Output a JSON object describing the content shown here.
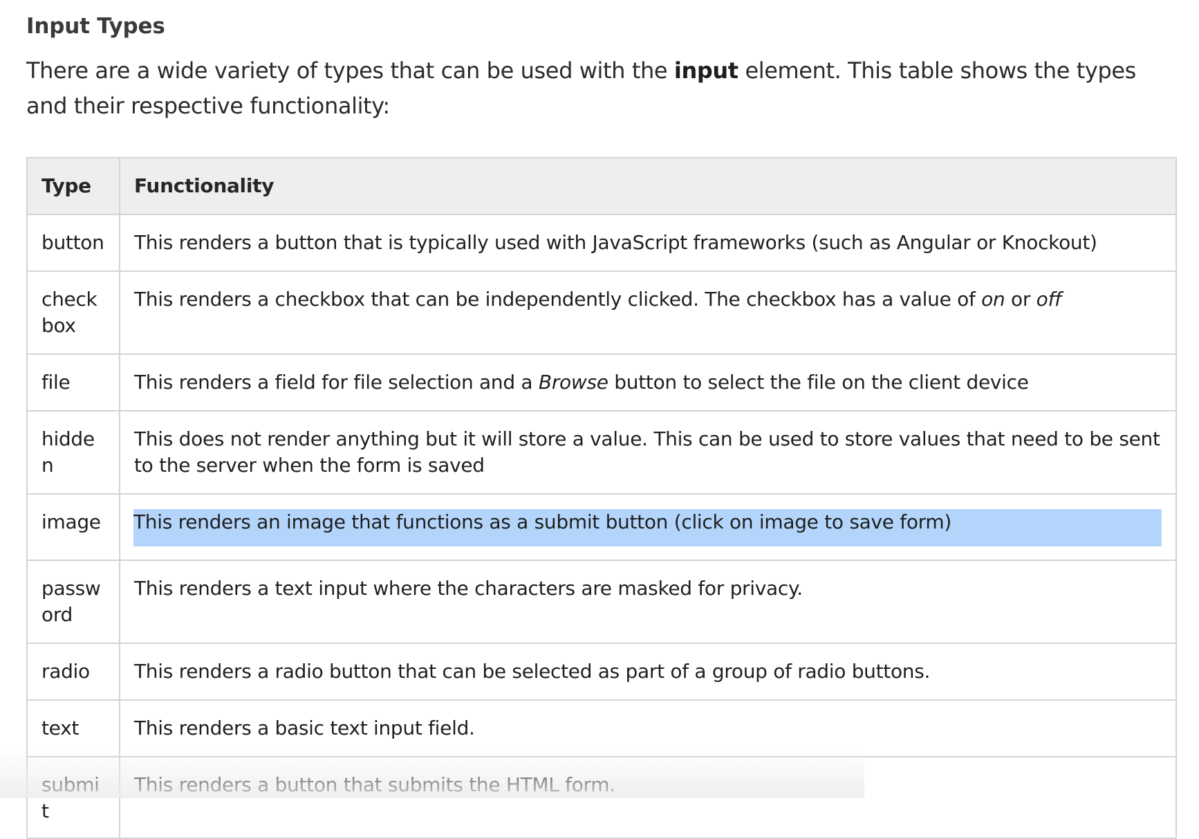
{
  "heading": "Input Types",
  "intro": {
    "before": "There are a wide variety of types that can be used with the ",
    "bold": "input",
    "after": " element. This table shows the types and their respective functionality:"
  },
  "table": {
    "headers": [
      "Type",
      "Functionality"
    ],
    "rows": [
      {
        "type": "button",
        "desc": "This renders a button that is typically used with JavaScript frameworks (such as Angular or Knockout)"
      },
      {
        "type": "checkbox",
        "desc_a": "This renders a checkbox that can be independently clicked. The checkbox has a value of ",
        "em1": "on",
        "desc_b": " or ",
        "em2": "off"
      },
      {
        "type": "file",
        "desc_a": "This renders a field for file selection and a ",
        "em1": "Browse",
        "desc_b": " button to select the file on the client device"
      },
      {
        "type": "hidden",
        "desc": "This does not render anything but it will store a value. This can be used to store values that need to be sent to the server when the form is saved"
      },
      {
        "type": "image",
        "desc": "This renders an image that functions as a submit button (click on image to save form)"
      },
      {
        "type": "password",
        "desc": "This renders a text input where the characters are masked for privacy."
      },
      {
        "type": "radio",
        "desc": "This renders a radio button that can be selected as part of a group of radio buttons."
      },
      {
        "type": "text",
        "desc": "This renders a basic text input field."
      },
      {
        "type": "submit",
        "desc": "This renders a button that submits the HTML form."
      }
    ]
  },
  "colors": {
    "text": "#2b2b2b",
    "header_bg": "#eeeeee",
    "border": "#d4d4d4",
    "selection": "#b4d5fb"
  }
}
